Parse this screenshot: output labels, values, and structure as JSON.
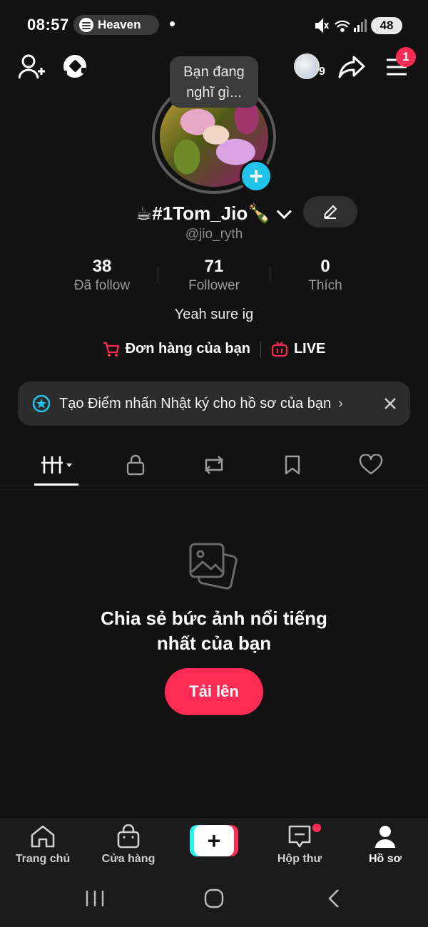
{
  "status_bar": {
    "time": "08:57",
    "media_app": "spotify-icon",
    "media_title": "Heaven",
    "battery": "48"
  },
  "profile": {
    "thought_bubble": "Bạn đang nghĩ gì...",
    "display_name": "☕#1Tom_Jio🍾",
    "username": "@jio_ryth",
    "friends_avatar_count": "9",
    "menu_badge": "1",
    "stats": [
      {
        "value": "38",
        "label": "Đã follow"
      },
      {
        "value": "71",
        "label": "Follower"
      },
      {
        "value": "0",
        "label": "Thích"
      }
    ],
    "bio": "Yeah sure ig",
    "orders_label": "Đơn hàng của bạn",
    "live_label": "LIVE"
  },
  "banner": {
    "text": "Tạo Điểm nhấn Nhật ký cho hồ sơ của bạn",
    "arrow": "›"
  },
  "tabs": [
    "grid-icon",
    "lock-icon",
    "repost-icon",
    "bookmark-icon",
    "heart-icon"
  ],
  "empty_state": {
    "title_line1": "Chia sẻ bức ảnh nổi tiếng",
    "title_line2": "nhất của bạn",
    "upload_label": "Tải lên"
  },
  "bottom_nav": {
    "home": "Trang chủ",
    "shop": "Cửa hàng",
    "create": "+",
    "inbox": "Hộp thư",
    "profile": "Hồ sơ"
  },
  "colors": {
    "background": "#121212",
    "accent": "#fe2c55",
    "cyan": "#25f4ee",
    "avatar_plus": "#20c4e8"
  }
}
